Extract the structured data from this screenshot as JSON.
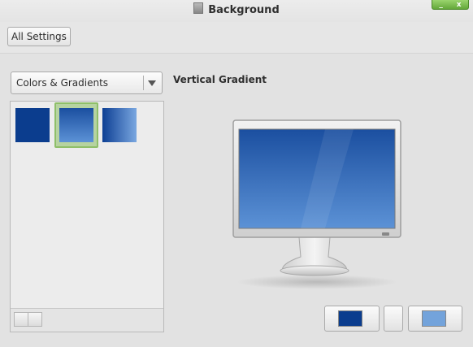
{
  "window": {
    "title": "Background",
    "minimize_label": "_",
    "close_label": "x"
  },
  "toolbar": {
    "all_settings_label": "All Settings"
  },
  "category": {
    "selected": "Colors & Gradients"
  },
  "wallpapers": [
    {
      "name": "Solid Color",
      "color": "#0b3d8e"
    },
    {
      "name": "Vertical Gradient",
      "top": "#1b4fa0",
      "bottom": "#5c92d6"
    },
    {
      "name": "Horizontal Gradient",
      "left": "#0d3f94",
      "right": "#7aa7e0"
    }
  ],
  "preview": {
    "title": "Vertical Gradient"
  },
  "colors": {
    "primary": "#0b3d8e",
    "secondary": "#73a3db",
    "selection_border": "#8ebf69"
  }
}
